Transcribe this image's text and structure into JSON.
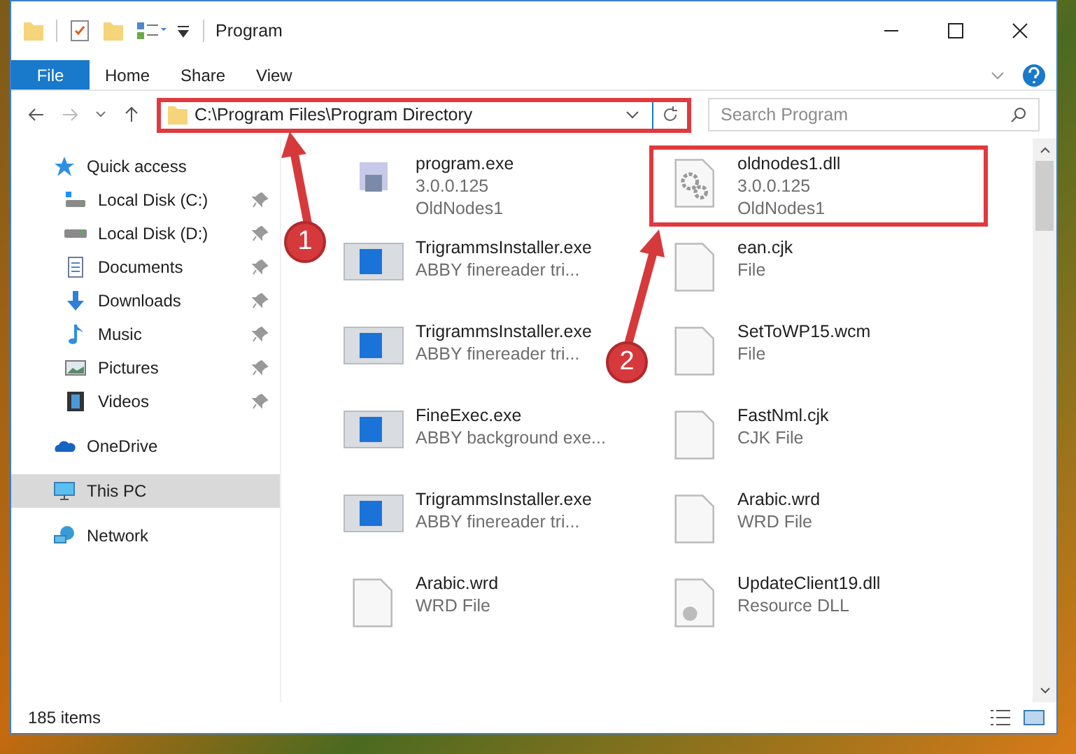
{
  "window": {
    "title": "Program"
  },
  "ribbon_tabs": [
    {
      "label": "File",
      "kind": "menu"
    },
    {
      "label": "Home",
      "kind": "tab"
    },
    {
      "label": "Share",
      "kind": "tab"
    },
    {
      "label": "View",
      "kind": "tab"
    }
  ],
  "address": {
    "path": "C:\\Program Files\\Program Directory",
    "highlighted": true
  },
  "search": {
    "placeholder": "Search Program"
  },
  "navigation": [
    {
      "label": "Quick access",
      "kind": "quick",
      "selected": false,
      "children": [
        {
          "label": "Local Disk (C:)",
          "kind": "system-drive",
          "selected": false,
          "pinned": true
        },
        {
          "label": "Local Disk (D:)",
          "kind": "drive",
          "selected": false,
          "pinned": true
        },
        {
          "label": "Documents",
          "kind": "documents",
          "selected": false,
          "pinned": true
        },
        {
          "label": "Downloads",
          "kind": "downloads",
          "selected": false,
          "pinned": true
        },
        {
          "label": "Music",
          "kind": "music",
          "selected": false,
          "pinned": true
        },
        {
          "label": "Pictures",
          "kind": "pictures",
          "selected": false,
          "pinned": true
        },
        {
          "label": "Videos",
          "kind": "videos",
          "selected": false,
          "pinned": true
        }
      ]
    },
    {
      "label": "OneDrive",
      "kind": "cloud",
      "selected": false
    },
    {
      "label": "This PC",
      "kind": "computer",
      "selected": true
    },
    {
      "label": "Network",
      "kind": "network",
      "selected": false
    }
  ],
  "files": [
    {
      "name": "program.exe",
      "lines": [
        "3.0.0.125",
        "OldNodes1"
      ],
      "kind": "installer",
      "highlighted": false
    },
    {
      "name": "oldnodes1.dll",
      "lines": [
        "3.0.0.125",
        "OldNodes1"
      ],
      "kind": "library",
      "highlighted": true
    },
    {
      "name": "TrigrammsInstaller.exe",
      "lines": [
        "ABBY finereader tri..."
      ],
      "kind": "program",
      "highlighted": false
    },
    {
      "name": "ean.cjk",
      "lines": [
        "File"
      ],
      "kind": "file",
      "highlighted": false
    },
    {
      "name": "TrigrammsInstaller.exe",
      "lines": [
        "ABBY finereader tri..."
      ],
      "kind": "program",
      "highlighted": false
    },
    {
      "name": "SetToWP15.wcm",
      "lines": [
        "File"
      ],
      "kind": "file",
      "highlighted": false
    },
    {
      "name": "FineExec.exe",
      "lines": [
        "ABBY background exe..."
      ],
      "kind": "program",
      "highlighted": false
    },
    {
      "name": "FastNml.cjk",
      "lines": [
        "CJK File"
      ],
      "kind": "file",
      "highlighted": false
    },
    {
      "name": "TrigrammsInstaller.exe",
      "lines": [
        "ABBY finereader tri..."
      ],
      "kind": "program",
      "highlighted": false
    },
    {
      "name": "Arabic.wrd",
      "lines": [
        "WRD File"
      ],
      "kind": "file",
      "highlighted": false
    },
    {
      "name": "Arabic.wrd",
      "lines": [
        "WRD File"
      ],
      "kind": "file",
      "highlighted": false
    },
    {
      "name": "UpdateClient19.dll",
      "lines": [
        "Resource DLL"
      ],
      "kind": "resource",
      "highlighted": false
    }
  ],
  "annotations": [
    {
      "number": "1"
    },
    {
      "number": "2"
    }
  ],
  "status_bar": {
    "count": "185 items"
  }
}
